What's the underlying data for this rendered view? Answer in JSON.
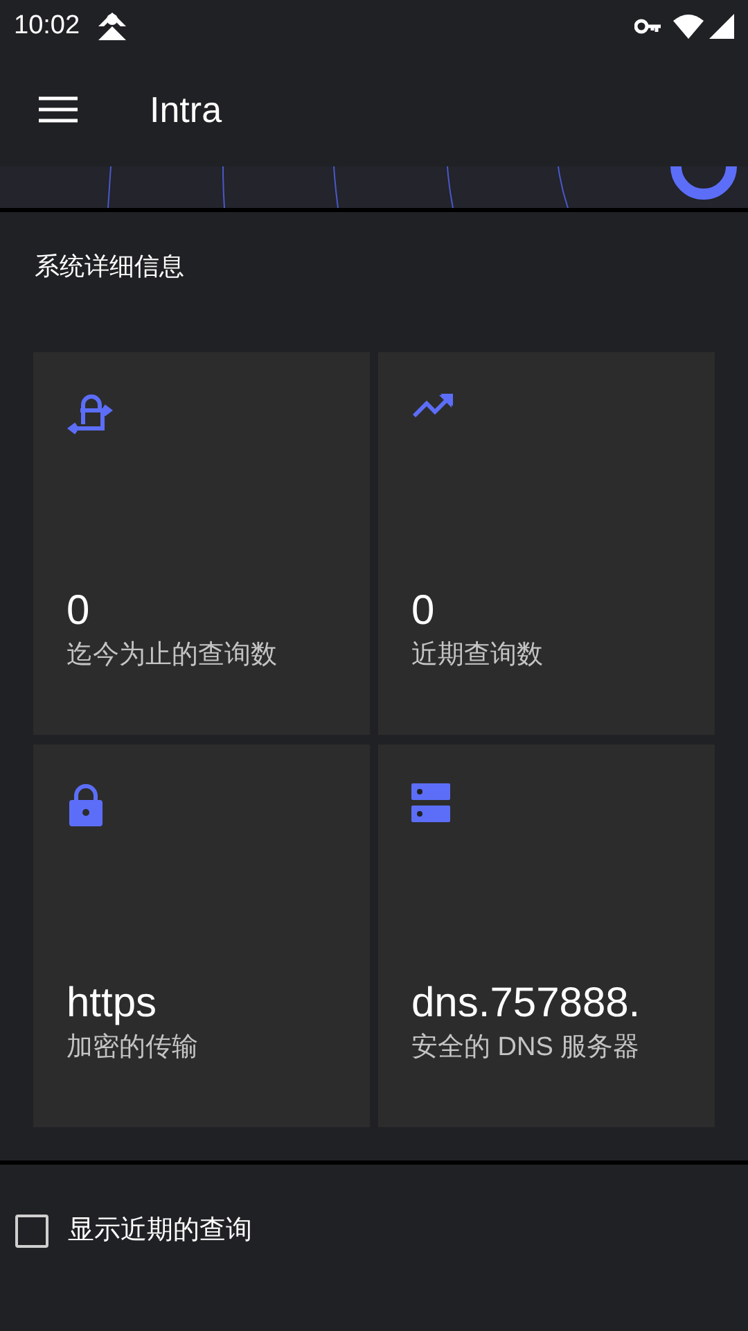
{
  "status_bar": {
    "time": "10:02"
  },
  "app_bar": {
    "title": "Intra"
  },
  "section": {
    "title": "系统详细信息"
  },
  "cards": [
    {
      "kind": "lock-swap",
      "value": "0",
      "label": "迄今为止的查询数"
    },
    {
      "kind": "trending",
      "value": "0",
      "label": "近期查询数"
    },
    {
      "kind": "lock",
      "value": "https",
      "label": "加密的传输"
    },
    {
      "kind": "server",
      "value": "dns.757888.",
      "label": "安全的 DNS 服务器"
    }
  ],
  "show_recent": {
    "label": "显示近期的查询",
    "checked": false
  }
}
